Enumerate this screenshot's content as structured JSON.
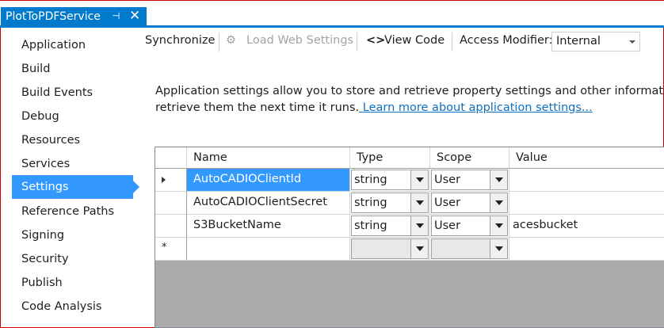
{
  "tab": {
    "title": "PlotToPDFService",
    "pin": "⊣",
    "close": "✕"
  },
  "sidebar": {
    "items": [
      {
        "label": "Application"
      },
      {
        "label": "Build"
      },
      {
        "label": "Build Events"
      },
      {
        "label": "Debug"
      },
      {
        "label": "Resources"
      },
      {
        "label": "Services"
      },
      {
        "label": "Settings",
        "active": true
      },
      {
        "label": "Reference Paths"
      },
      {
        "label": "Signing"
      },
      {
        "label": "Security"
      },
      {
        "label": "Publish"
      },
      {
        "label": "Code Analysis"
      }
    ]
  },
  "toolbar": {
    "synchronize": "Synchronize",
    "load_web_settings": "Load Web Settings",
    "view_code": "View Code",
    "access_modifier_label": "Access Modifier:",
    "access_modifier_value": "Internal"
  },
  "description": {
    "line1": "Application settings allow you to store and retrieve property settings and other information for",
    "line2": "retrieve them the next time it runs.",
    "link": " Learn more about application settings..."
  },
  "grid": {
    "columns": [
      "Name",
      "Type",
      "Scope",
      "Value"
    ],
    "rows": [
      {
        "name": "AutoCADIOClientId",
        "type": "string",
        "scope": "User",
        "value": ""
      },
      {
        "name": "AutoCADIOClientSecret",
        "type": "string",
        "scope": "User",
        "value": ""
      },
      {
        "name": "S3BucketName",
        "type": "string",
        "scope": "User",
        "value": "acesbucket"
      },
      {
        "name": "",
        "type": "",
        "scope": "",
        "value": ""
      }
    ],
    "new_row_marker": "*"
  },
  "colors": {
    "accent": "#007acc",
    "selection": "#3399ff",
    "link": "#0e70c0"
  }
}
